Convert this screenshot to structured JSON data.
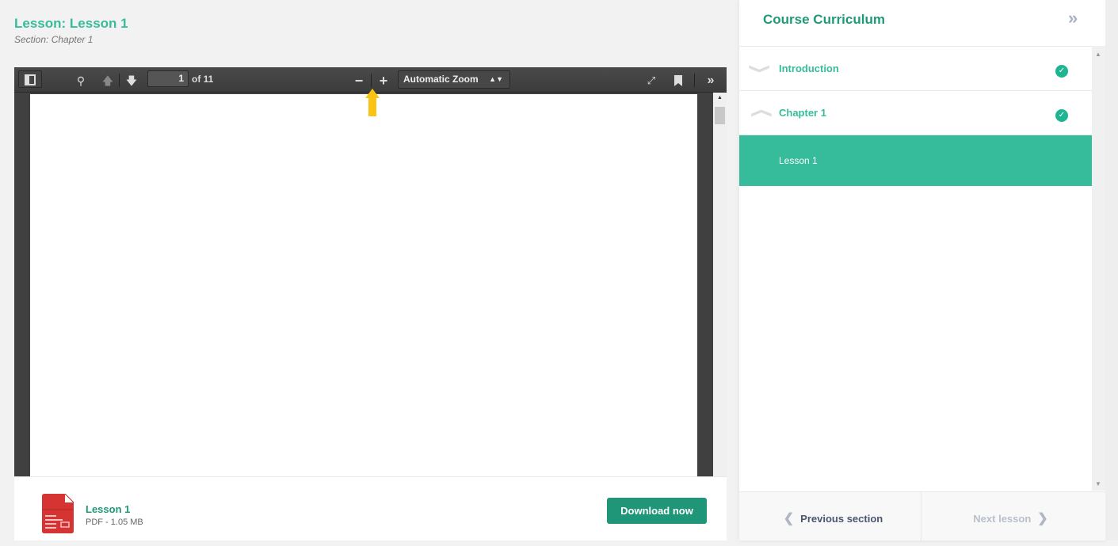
{
  "lesson": {
    "title": "Lesson: Lesson 1",
    "section": "Section: Chapter 1"
  },
  "viewer": {
    "page_current": "1",
    "page_total_label": "of 11",
    "zoom_value": "Automatic Zoom",
    "icons": [
      "sidebar-toggle-icon",
      "search-icon",
      "previous-page-icon",
      "next-page-icon",
      "zoom-out-icon",
      "zoom-in-icon",
      "fullscreen-icon",
      "bookmark-icon",
      "tools-icon"
    ]
  },
  "annotation": {
    "color": "#fbc313",
    "points_to": "zoom-in-button"
  },
  "file": {
    "name": "Lesson 1",
    "meta": "PDF - 1.05 MB",
    "download_label": "Download now",
    "icon": "pdf-file-icon"
  },
  "curriculum": {
    "title": "Course Curriculum",
    "sections": [
      {
        "name": "Introduction",
        "completed": true,
        "expanded": false
      },
      {
        "name": "Chapter 1",
        "completed": true,
        "expanded": true
      }
    ],
    "lessons": [
      {
        "name": "Lesson 1",
        "active": true
      }
    ],
    "prev_label": "Previous section",
    "next_label": "Next lesson"
  },
  "colors": {
    "accent": "#37bc9b",
    "accent_dark": "#1f9677",
    "toolbar": "#404040"
  }
}
